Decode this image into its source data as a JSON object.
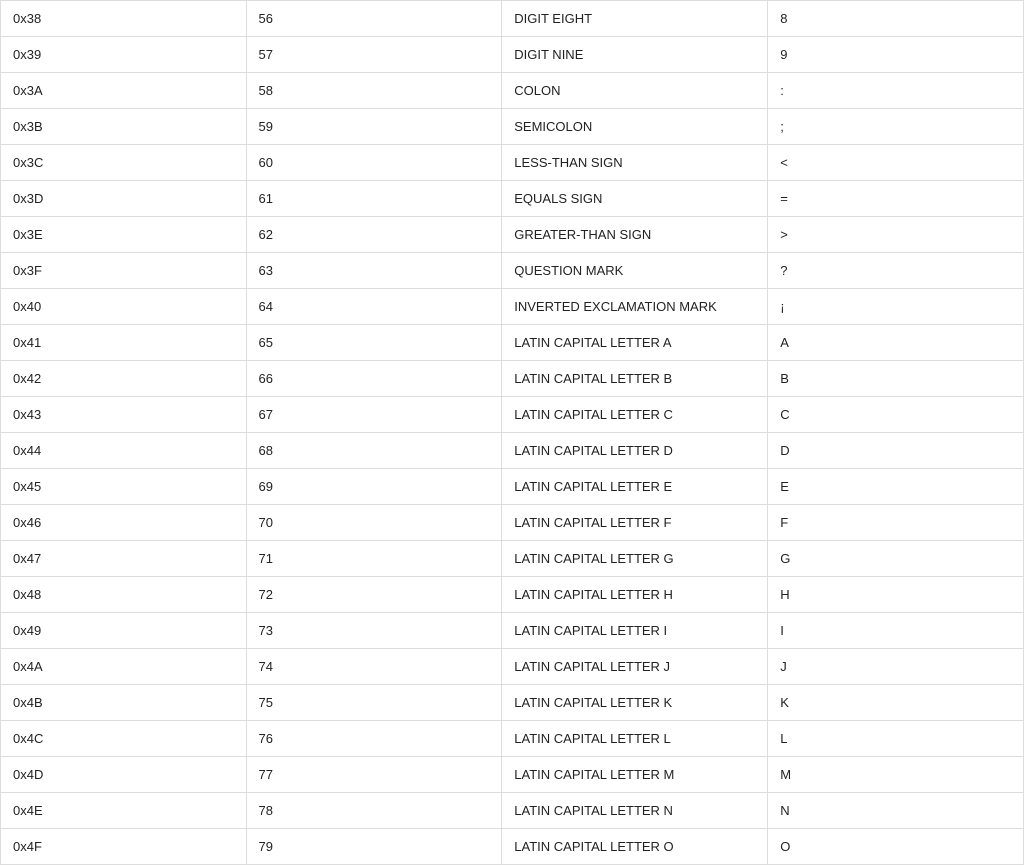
{
  "rows": [
    {
      "hex": "0x38",
      "dec": "56",
      "name": "DIGIT EIGHT",
      "char": "8"
    },
    {
      "hex": "0x39",
      "dec": "57",
      "name": "DIGIT NINE",
      "char": "9"
    },
    {
      "hex": "0x3A",
      "dec": "58",
      "name": "COLON",
      "char": ":"
    },
    {
      "hex": "0x3B",
      "dec": "59",
      "name": "SEMICOLON",
      "char": ";"
    },
    {
      "hex": "0x3C",
      "dec": "60",
      "name": "LESS-THAN SIGN",
      "char": "<"
    },
    {
      "hex": "0x3D",
      "dec": "61",
      "name": "EQUALS SIGN",
      "char": "="
    },
    {
      "hex": "0x3E",
      "dec": "62",
      "name": "GREATER-THAN SIGN",
      "char": ">"
    },
    {
      "hex": "0x3F",
      "dec": "63",
      "name": "QUESTION MARK",
      "char": "?"
    },
    {
      "hex": "0x40",
      "dec": "64",
      "name": "INVERTED EXCLAMATION MARK",
      "char": "¡"
    },
    {
      "hex": "0x41",
      "dec": "65",
      "name": "LATIN CAPITAL LETTER A",
      "char": "A"
    },
    {
      "hex": "0x42",
      "dec": "66",
      "name": "LATIN CAPITAL LETTER B",
      "char": "B"
    },
    {
      "hex": "0x43",
      "dec": "67",
      "name": "LATIN CAPITAL LETTER C",
      "char": "C"
    },
    {
      "hex": "0x44",
      "dec": "68",
      "name": "LATIN CAPITAL LETTER D",
      "char": "D"
    },
    {
      "hex": "0x45",
      "dec": "69",
      "name": "LATIN CAPITAL LETTER E",
      "char": "E"
    },
    {
      "hex": "0x46",
      "dec": "70",
      "name": "LATIN CAPITAL LETTER F",
      "char": "F"
    },
    {
      "hex": "0x47",
      "dec": "71",
      "name": "LATIN CAPITAL LETTER G",
      "char": "G"
    },
    {
      "hex": "0x48",
      "dec": "72",
      "name": "LATIN CAPITAL LETTER H",
      "char": "H"
    },
    {
      "hex": "0x49",
      "dec": "73",
      "name": "LATIN CAPITAL LETTER I",
      "char": "I"
    },
    {
      "hex": "0x4A",
      "dec": "74",
      "name": "LATIN CAPITAL LETTER J",
      "char": "J"
    },
    {
      "hex": "0x4B",
      "dec": "75",
      "name": "LATIN CAPITAL LETTER K",
      "char": "K"
    },
    {
      "hex": "0x4C",
      "dec": "76",
      "name": "LATIN CAPITAL LETTER L",
      "char": "L"
    },
    {
      "hex": "0x4D",
      "dec": "77",
      "name": "LATIN CAPITAL LETTER M",
      "char": "M"
    },
    {
      "hex": "0x4E",
      "dec": "78",
      "name": "LATIN CAPITAL LETTER N",
      "char": "N"
    },
    {
      "hex": "0x4F",
      "dec": "79",
      "name": "LATIN CAPITAL LETTER O",
      "char": "O"
    }
  ]
}
